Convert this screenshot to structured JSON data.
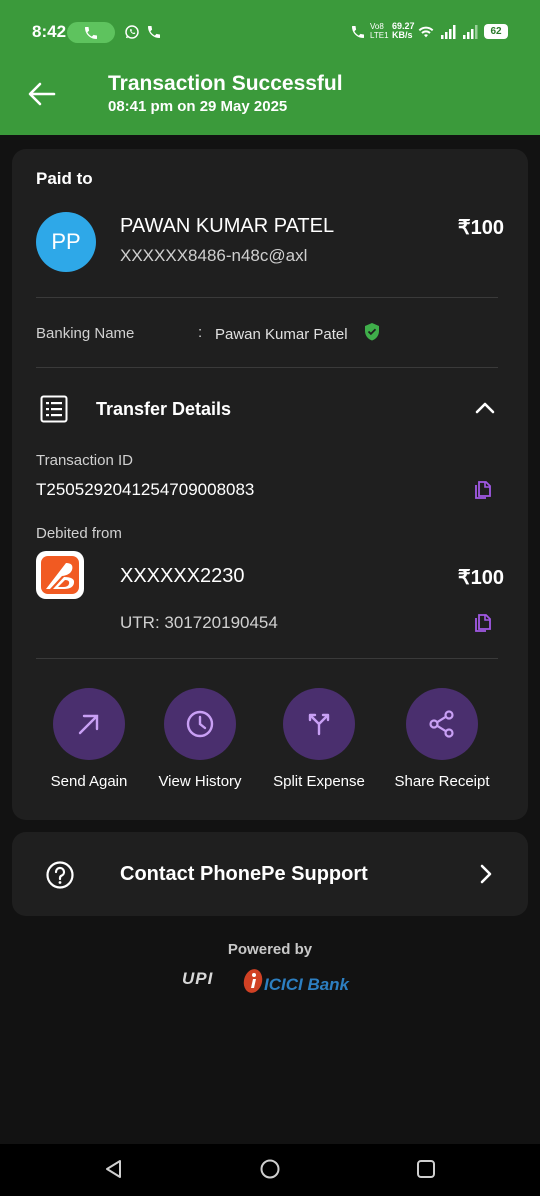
{
  "status_bar": {
    "time": "8:42",
    "network_speed_value": "69.27",
    "network_speed_unit": "KB/s",
    "volte": "Vo8",
    "lte": "LTE1",
    "battery": "62"
  },
  "header": {
    "title": "Transaction Successful",
    "subtitle": "08:41 pm on 29 May 2025"
  },
  "paid_to": {
    "label": "Paid to",
    "avatar_initials": "PP",
    "name": "PAWAN KUMAR PATEL",
    "upi_id": "XXXXXX8486-n48c@axl",
    "amount": "₹100"
  },
  "banking": {
    "label": "Banking Name",
    "colon": ":",
    "value": "Pawan Kumar Patel"
  },
  "transfer_details": {
    "title": "Transfer Details",
    "transaction_id_label": "Transaction ID",
    "transaction_id": "T2505292041254709008083",
    "debited_from_label": "Debited from",
    "account": "XXXXXX2230",
    "amount": "₹100",
    "utr": "UTR: 301720190454"
  },
  "actions": [
    {
      "label": "Send Again",
      "icon": "arrow-up-right-icon"
    },
    {
      "label": "View History",
      "icon": "clock-icon"
    },
    {
      "label": "Split Expense",
      "icon": "split-icon"
    },
    {
      "label": "Share Receipt",
      "icon": "share-icon"
    }
  ],
  "support": {
    "label": "Contact PhonePe Support"
  },
  "footer": {
    "powered_by": "Powered by",
    "upi_logo_text": "UPI",
    "bank_logo_text": "ICICI Bank"
  },
  "colors": {
    "header_green": "#3b9a3b",
    "card_bg": "#1f1f1f",
    "action_circle": "#4a2f6e",
    "accent_purple": "#a259e6",
    "avatar_blue": "#2ea8e8",
    "verified_green": "#3fae4a"
  }
}
